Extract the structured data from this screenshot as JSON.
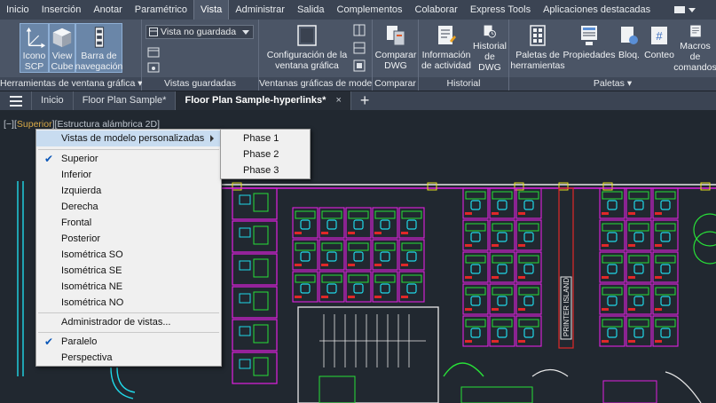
{
  "ribbon_tabs": [
    "Inicio",
    "Inserción",
    "Anotar",
    "Paramétrico",
    "Vista",
    "Administrar",
    "Salida",
    "Complementos",
    "Colaborar",
    "Express Tools",
    "Aplicaciones destacadas"
  ],
  "active_tab": "Vista",
  "panels": {
    "viewport_tools": {
      "title": "Herramientas de ventana gráfica",
      "buttons": [
        {
          "label_1": "Icono",
          "label_2": "SCP"
        },
        {
          "label_1": "View",
          "label_2": "Cube"
        },
        {
          "label_1": "Barra de",
          "label_2": "navegación"
        }
      ]
    },
    "saved_views": {
      "title": "Vistas guardadas",
      "dropdown_value": "Vista no guardada"
    },
    "model_viewports": {
      "title": "Ventanas gráficas de modelo",
      "config_label_1": "Configuración de la",
      "config_label_2": "ventana gráfica"
    },
    "compare": {
      "title": "Comparar",
      "button_1": "Comparar",
      "button_2": "DWG"
    },
    "history": {
      "title": "Historial",
      "activity_1": "Información",
      "activity_2": "de actividad",
      "dwg_history_1": "Historial",
      "dwg_history_2": "de DWG"
    },
    "palettes": {
      "title": "Paletas",
      "tool_palettes_1": "Paletas de",
      "tool_palettes_2": "herramientas",
      "properties": "Propiedades",
      "blocks": "Bloq.",
      "count": "Conteo",
      "macros_1": "Macros de",
      "macros_2": "comandos"
    }
  },
  "doc_tabs": {
    "home": "Inicio",
    "tab_1": "Floor Plan Sample*",
    "tab_2": "Floor Plan Sample-hyperlinks*",
    "close": "×",
    "new": "+"
  },
  "viewport_label": {
    "prefix": "[−][",
    "view": "Superior",
    "mid": "][",
    "style": "Estructura alámbrica 2D",
    "suffix": "]"
  },
  "drawing_text": {
    "printer_island": "PRINTER ISLAND"
  },
  "context_menu": {
    "items": [
      {
        "label": "Vistas de modelo personalizadas",
        "checked": false,
        "submenu": true,
        "hover": true
      },
      {
        "label": "Superior",
        "checked": true
      },
      {
        "label": "Inferior",
        "checked": false
      },
      {
        "label": "Izquierda",
        "checked": false
      },
      {
        "label": "Derecha",
        "checked": false
      },
      {
        "label": "Frontal",
        "checked": false
      },
      {
        "label": "Posterior",
        "checked": false
      },
      {
        "label": "Isométrica SO",
        "checked": false
      },
      {
        "label": "Isométrica SE",
        "checked": false
      },
      {
        "label": "Isométrica NE",
        "checked": false
      },
      {
        "label": "Isométrica NO",
        "checked": false
      },
      {
        "label": "Administrador de vistas...",
        "checked": false
      },
      {
        "label": "Paralelo",
        "checked": true
      },
      {
        "label": "Perspectiva",
        "checked": false
      }
    ],
    "check_glyph": "✔"
  },
  "submenu": [
    "Phase 1",
    "Phase 2",
    "Phase 3"
  ],
  "colors": {
    "magenta": "#e020e0",
    "cyan": "#20d8e8",
    "green": "#28e038",
    "yellow": "#e8e020",
    "red": "#e02828",
    "white": "#e8e8e8",
    "menu_hover": "#c8dcf0"
  }
}
